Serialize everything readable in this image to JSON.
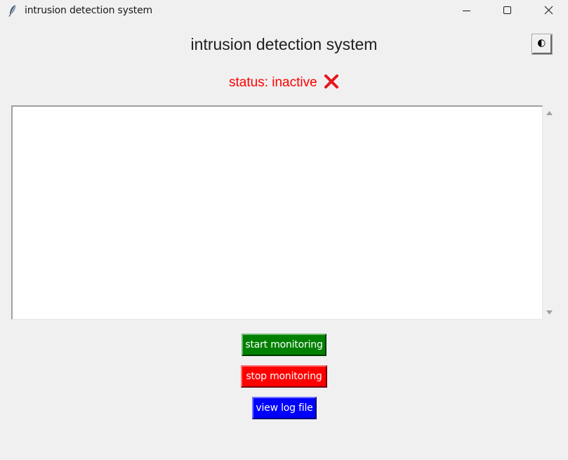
{
  "window": {
    "title": "intrusion detection system",
    "app_icon": "feather-icon",
    "controls": [
      "minimize-icon",
      "maximize-icon",
      "close-icon"
    ]
  },
  "header": {
    "title": "intrusion detection system",
    "theme_toggle_icon": "theme-toggle-icon",
    "theme_toggle_glyph": "🌓"
  },
  "status": {
    "text": "status: inactive",
    "icon": "cross-mark-icon",
    "color": "#ff0000"
  },
  "log": {
    "value": ""
  },
  "buttons": {
    "start_label": "start monitoring",
    "start_color": "#008000",
    "stop_label": "stop monitoring",
    "stop_color": "#ff0000",
    "view_log_label": "view log file",
    "view_log_color": "#0000ff"
  }
}
